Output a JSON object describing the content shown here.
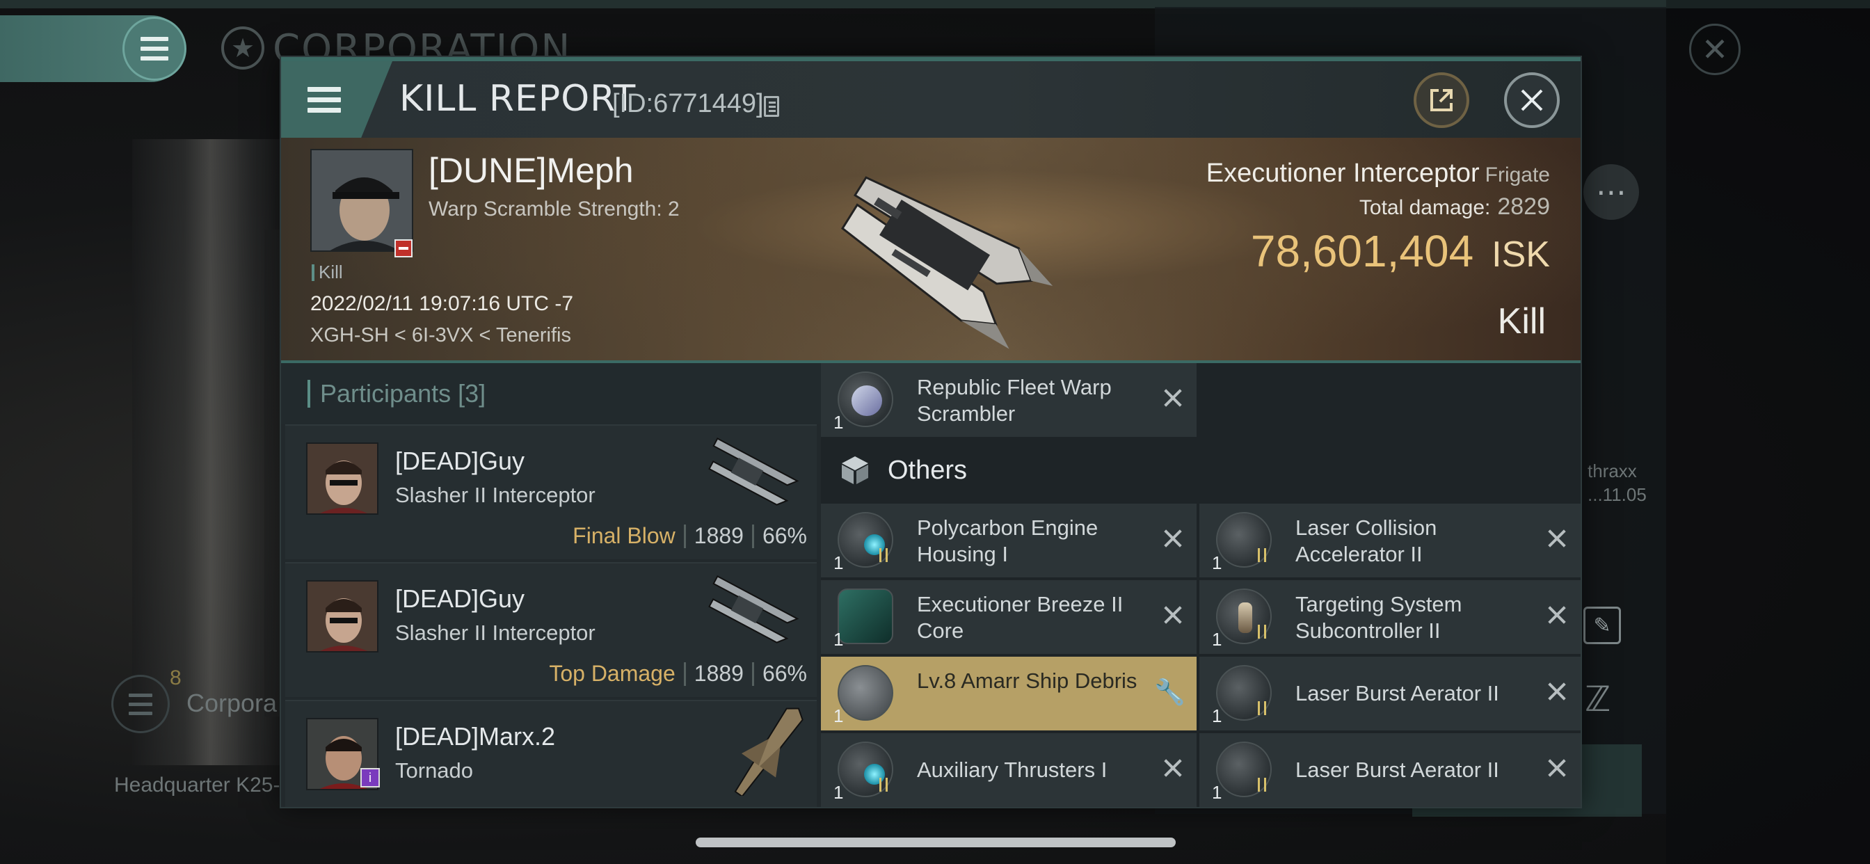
{
  "background": {
    "corp_title": "CORPORATION",
    "corp_row_count": "8",
    "corp_row_label": "Corpora",
    "hq_label": "Headquarter K25-",
    "side_user_name": "thraxx",
    "side_user_date": "...11.05"
  },
  "header": {
    "title": "KILL REPORT",
    "report_id": "[ID:6771449]"
  },
  "victim": {
    "name": "[DUNE]Meph",
    "subtitle": "Warp Scramble Strength: 2",
    "tag": "Kill",
    "datetime": "2022/02/11 19:07:16 UTC -7",
    "location": "XGH-SH < 6I-3VX < Tenerifis",
    "ship_name": "Executioner Interceptor",
    "ship_class": "Frigate",
    "total_damage_label": "Total damage:",
    "total_damage_value": "2829",
    "isk_value": "78,601,404",
    "isk_unit": "ISK",
    "result": "Kill"
  },
  "participants": {
    "header": "Participants [3]",
    "rows": [
      {
        "name": "[DEAD]Guy",
        "ship": "Slasher II Interceptor",
        "label": "Final Blow",
        "damage": "1889",
        "percent": "66%"
      },
      {
        "name": "[DEAD]Guy",
        "ship": "Slasher II Interceptor",
        "label": "Top Damage",
        "damage": "1889",
        "percent": "66%"
      },
      {
        "name": "[DEAD]Marx.2",
        "ship": "Tornado",
        "label": "",
        "damage": "",
        "percent": ""
      }
    ]
  },
  "items": {
    "top": {
      "qty": "1",
      "name": "Republic Fleet Warp Scrambler"
    },
    "others_header": "Others",
    "left": [
      {
        "qty": "1",
        "name": "Polycarbon Engine Housing I"
      },
      {
        "qty": "1",
        "name": "Executioner Breeze II Core"
      },
      {
        "qty": "1",
        "name": "Lv.8 Amarr Ship Debris"
      },
      {
        "qty": "1",
        "name": "Auxiliary Thrusters I"
      }
    ],
    "right": [
      {
        "qty": "1",
        "name": "Laser Collision Accelerator II"
      },
      {
        "qty": "1",
        "name": "Targeting System Subcontroller II"
      },
      {
        "qty": "1",
        "name": "Laser Burst Aerator II"
      },
      {
        "qty": "1",
        "name": "Laser Burst Aerator II"
      }
    ]
  },
  "colors": {
    "accent_teal": "#3e6862",
    "isk_gold": "#e9c37a",
    "highlight_row": "#b6a066",
    "label_gold": "#d7b167"
  }
}
